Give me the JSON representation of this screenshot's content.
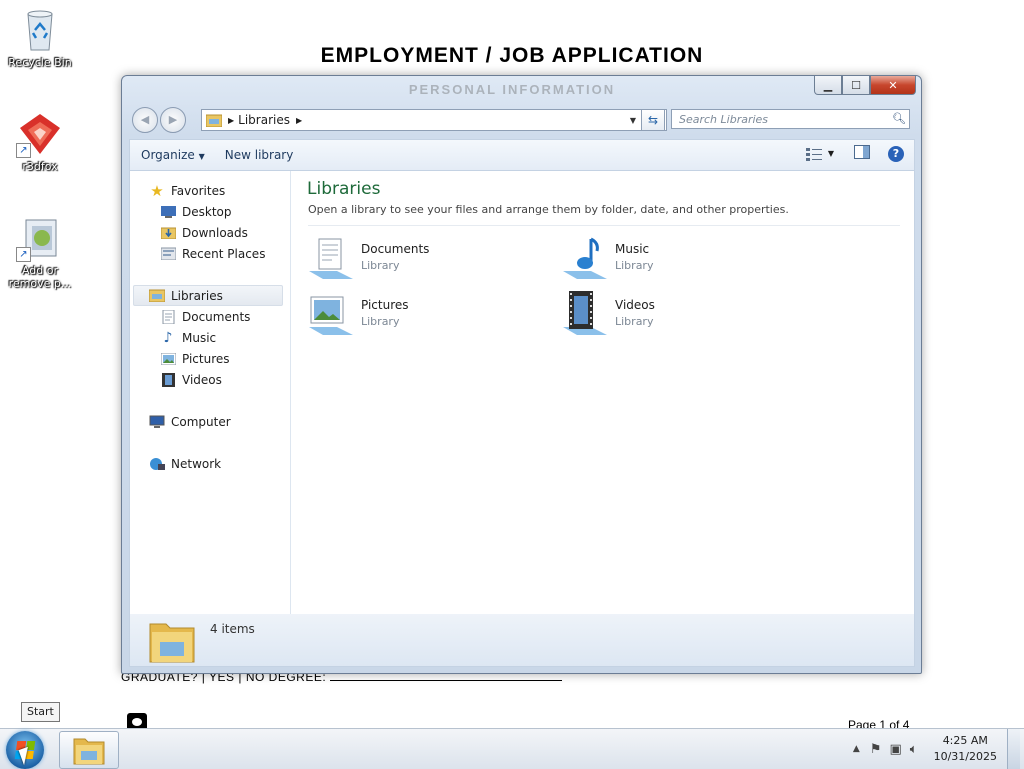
{
  "document": {
    "title": "EMPLOYMENT / JOB APPLICATION",
    "section": "PERSONAL INFORMATION",
    "graduate_line": "GRADUATE?  |  YES  |  NO  DEGREE:",
    "page": "Page 1 of 4"
  },
  "desktop": {
    "icons": [
      {
        "label": "Recycle Bin"
      },
      {
        "label": "r3dfox"
      },
      {
        "label": "Add or remove p..."
      }
    ]
  },
  "window": {
    "address": {
      "crumb": "Libraries"
    },
    "search_placeholder": "Search Libraries",
    "toolbar": {
      "organize": "Organize",
      "new_library": "New library"
    },
    "nav": {
      "favorites": "Favorites",
      "favorites_items": [
        "Desktop",
        "Downloads",
        "Recent Places"
      ],
      "libraries": "Libraries",
      "libraries_items": [
        "Documents",
        "Music",
        "Pictures",
        "Videos"
      ],
      "computer": "Computer",
      "network": "Network"
    },
    "content": {
      "title": "Libraries",
      "description": "Open a library to see your files and arrange them by folder, date, and other properties.",
      "tiles": [
        {
          "name": "Documents",
          "type": "Library",
          "icon": "documents-library-icon"
        },
        {
          "name": "Music",
          "type": "Library",
          "icon": "music-library-icon"
        },
        {
          "name": "Pictures",
          "type": "Library",
          "icon": "pictures-library-icon"
        },
        {
          "name": "Videos",
          "type": "Library",
          "icon": "videos-library-icon"
        }
      ]
    },
    "details": {
      "count": "4 items"
    }
  },
  "taskbar": {
    "start_tooltip": "Start",
    "clock": {
      "time": "4:25 AM",
      "date": "10/31/2025"
    }
  }
}
